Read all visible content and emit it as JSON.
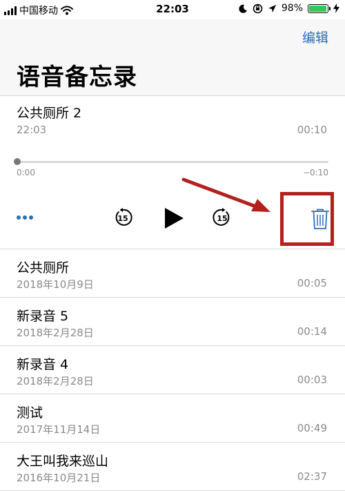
{
  "status_bar": {
    "carrier": "中国移动",
    "time": "22:03",
    "battery_percent": "98%",
    "battery_level": 0.98
  },
  "nav": {
    "edit_label": "编辑",
    "title": "语音备忘录"
  },
  "expanded_recording": {
    "title": "公共厕所 2",
    "date": "22:03",
    "duration": "00:10",
    "elapsed": "0:00",
    "remaining": "−0:10",
    "skip_back_seconds": "15",
    "skip_forward_seconds": "15"
  },
  "recordings": [
    {
      "title": "公共厕所",
      "date": "2018年10月9日",
      "duration": "00:05"
    },
    {
      "title": "新录音 5",
      "date": "2018年2月28日",
      "duration": "00:14"
    },
    {
      "title": "新录音 4",
      "date": "2018年2月28日",
      "duration": "00:03"
    },
    {
      "title": "测试",
      "date": "2017年11月14日",
      "duration": "00:49"
    },
    {
      "title": "大王叫我来巡山",
      "date": "2016年10月21日",
      "duration": "02:37"
    }
  ],
  "colors": {
    "accent": "#2a6fb8",
    "annotation": "#b3201d",
    "battery": "#34c759"
  }
}
